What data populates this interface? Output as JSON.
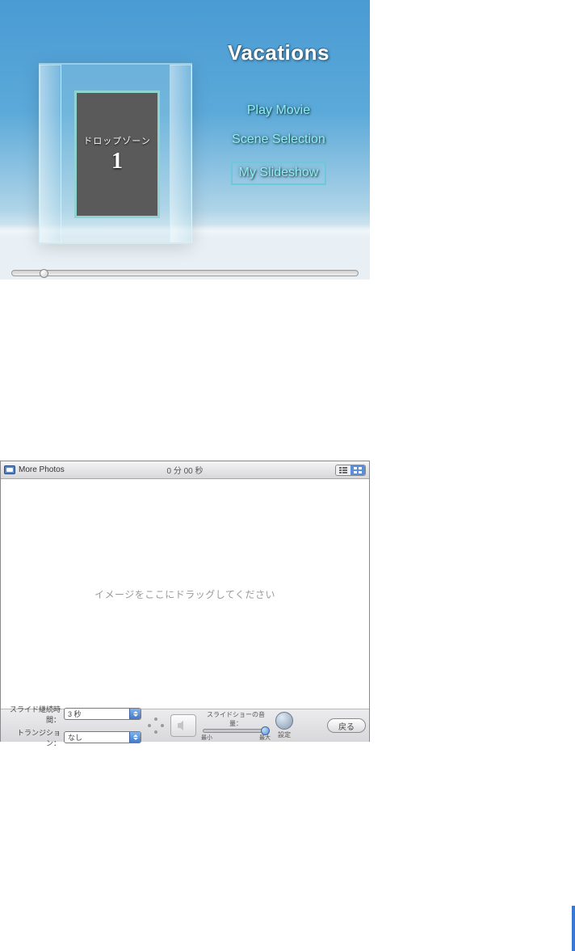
{
  "dvd": {
    "title": "Vacations",
    "drop_zone_label": "ドロップゾーン",
    "drop_zone_number": "1",
    "menu": {
      "play_movie": "Play Movie",
      "scene_selection": "Scene Selection",
      "my_slideshow": "My Slideshow"
    }
  },
  "slideshow": {
    "header": {
      "title": "More Photos",
      "time": "0 分 00 秒"
    },
    "canvas_prompt": "イメージをここにドラッグしてください",
    "labels": {
      "duration": "スライド継続時間：",
      "transition": "トランジション："
    },
    "values": {
      "duration": "3 秒",
      "transition": "なし"
    },
    "volume": {
      "title": "スライドショーの音量：",
      "min": "最小",
      "max": "最大"
    },
    "settings_label": "設定",
    "back_label": "戻る"
  }
}
